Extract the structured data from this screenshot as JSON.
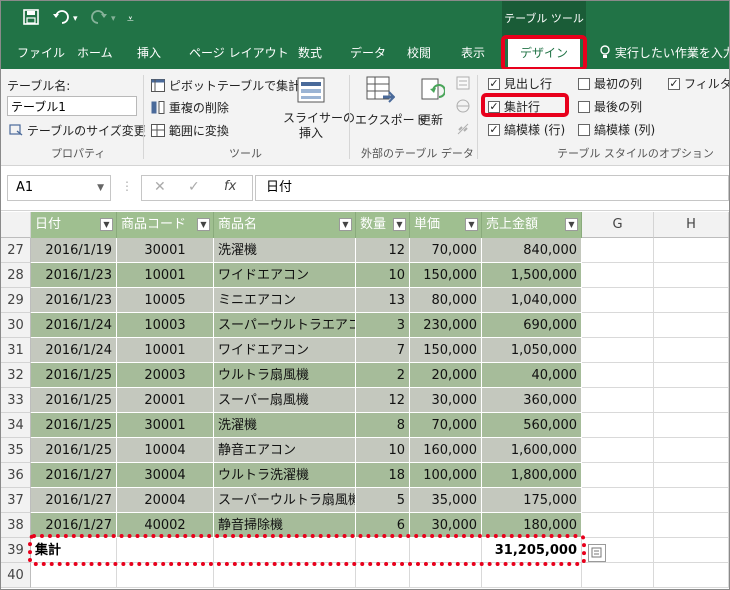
{
  "titlebar": {
    "context_tab": "テーブル ツール"
  },
  "tabs": [
    "ファイル",
    "ホーム",
    "挿入",
    "ページ レイアウト",
    "数式",
    "データ",
    "校閲",
    "表示",
    "デザイン"
  ],
  "active_tab": "デザイン",
  "tell_me": "実行したい作業を入力",
  "ribbon": {
    "properties": {
      "name_label": "テーブル名:",
      "name_value": "テーブル1",
      "resize": "テーブルのサイズ変更",
      "group": "プロパティ"
    },
    "tools": {
      "pivot": "ピボットテーブルで集計",
      "remove_dup": "重複の削除",
      "convert": "範囲に変換",
      "slicer_1": "スライサーの",
      "slicer_2": "挿入",
      "group": "ツール"
    },
    "external": {
      "export": "エクスポート",
      "refresh": "更新",
      "group": "外部のテーブル データ"
    },
    "style_options": {
      "header_row": "見出し行",
      "total_row": "集計行",
      "banded_rows": "縞模様 (行)",
      "first_col": "最初の列",
      "last_col": "最後の列",
      "banded_cols": "縞模様 (列)",
      "filter": "フィルター",
      "group": "テーブル スタイルのオプション"
    }
  },
  "formula": {
    "name_box": "A1",
    "cancel": "✕",
    "enter": "✓",
    "fx": "fx",
    "value": "日付"
  },
  "columns": [
    "G",
    "H"
  ],
  "headers": [
    "日付",
    "商品コード",
    "商品名",
    "数量",
    "単価",
    "売上金額"
  ],
  "rows": [
    {
      "n": "27",
      "date": "2016/1/19",
      "code": "30001",
      "name": "洗濯機",
      "qty": "12",
      "price": "70,000",
      "amount": "840,000"
    },
    {
      "n": "28",
      "date": "2016/1/23",
      "code": "10001",
      "name": "ワイドエアコン",
      "qty": "10",
      "price": "150,000",
      "amount": "1,500,000"
    },
    {
      "n": "29",
      "date": "2016/1/23",
      "code": "10005",
      "name": "ミニエアコン",
      "qty": "13",
      "price": "80,000",
      "amount": "1,040,000"
    },
    {
      "n": "30",
      "date": "2016/1/24",
      "code": "10003",
      "name": "スーパーウルトラエアコン",
      "qty": "3",
      "price": "230,000",
      "amount": "690,000"
    },
    {
      "n": "31",
      "date": "2016/1/24",
      "code": "10001",
      "name": "ワイドエアコン",
      "qty": "7",
      "price": "150,000",
      "amount": "1,050,000"
    },
    {
      "n": "32",
      "date": "2016/1/25",
      "code": "20003",
      "name": "ウルトラ扇風機",
      "qty": "2",
      "price": "20,000",
      "amount": "40,000"
    },
    {
      "n": "33",
      "date": "2016/1/25",
      "code": "20001",
      "name": "スーパー扇風機",
      "qty": "12",
      "price": "30,000",
      "amount": "360,000"
    },
    {
      "n": "34",
      "date": "2016/1/25",
      "code": "30001",
      "name": "洗濯機",
      "qty": "8",
      "price": "70,000",
      "amount": "560,000"
    },
    {
      "n": "35",
      "date": "2016/1/25",
      "code": "10004",
      "name": "静音エアコン",
      "qty": "10",
      "price": "160,000",
      "amount": "1,600,000"
    },
    {
      "n": "36",
      "date": "2016/1/27",
      "code": "30004",
      "name": "ウルトラ洗濯機",
      "qty": "18",
      "price": "100,000",
      "amount": "1,800,000"
    },
    {
      "n": "37",
      "date": "2016/1/27",
      "code": "20004",
      "name": "スーパーウルトラ扇風機",
      "qty": "5",
      "price": "35,000",
      "amount": "175,000"
    },
    {
      "n": "38",
      "date": "2016/1/27",
      "code": "40002",
      "name": "静音掃除機",
      "qty": "6",
      "price": "30,000",
      "amount": "180,000"
    }
  ],
  "total_row": {
    "n": "39",
    "label": "集計",
    "amount": "31,205,000"
  },
  "empty_row": {
    "n": "40"
  },
  "colors": {
    "accent": "#217346",
    "table_header": "#9fbf90",
    "band_dark": "#c4c8be",
    "band_light": "#a6bc9a",
    "highlight": "#e8001c"
  }
}
